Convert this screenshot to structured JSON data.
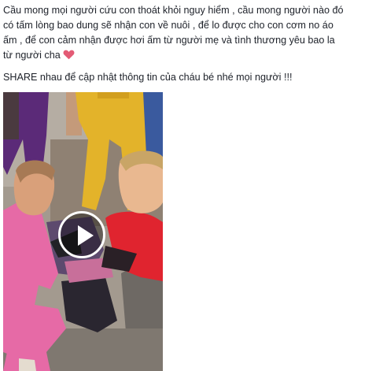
{
  "post": {
    "lines": [
      "Cầu mong mọi người cứu con thoát khỏi nguy hiểm , cầu mong người nào đó",
      "có tấm lòng bao dung sẽ nhận con về nuôi , để lo được cho con cơm no áo",
      "ấm , để con cảm nhận được hơi ấm từ người mẹ và tình thương yêu bao la",
      "từ người cha"
    ],
    "share_text": "SHARE nhau để cập nhật thông tin của cháu bé nhé mọi người !!!"
  },
  "video": {
    "play_icon": "play-icon",
    "thumbnail_icon": "video-thumbnail"
  },
  "colors": {
    "text": "#1d2129",
    "heart": "#e35b75",
    "pink_shirt": "#e66aa6",
    "red_shirt": "#e0242f",
    "yellow_pants": "#e3b32a",
    "purple_pants": "#5b2a78",
    "play_ring": "#ffffff"
  }
}
